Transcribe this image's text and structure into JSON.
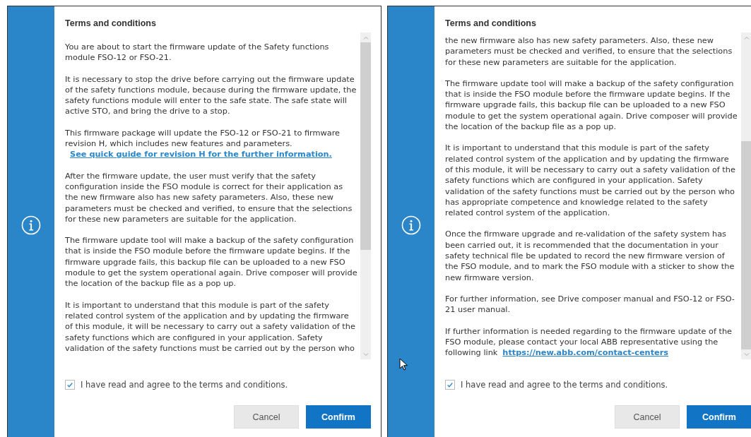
{
  "dialogs": [
    {
      "title": "Terms and conditions",
      "pointer": false,
      "paragraphs": [
        {
          "text": "You are about to start the firmware update of the Safety functions module FSO-12 or FSO-21."
        },
        {
          "text": "It is necessary to stop the drive before carrying out the firmware update of the safety functions module, because during the firmware update, the safety functions module will enter to the safe state. The safe state will active STO, and bring the drive to a stop."
        },
        {
          "text": "This firmware package will update the FSO-12 or FSO-21 to firmware revision H, which includes new features and parameters.",
          "link": "See quick guide for revision H for the further information."
        },
        {
          "text": "After the firmware update, the user must verify that the safety configuration inside the FSO module is correct for their application as the new firmware also has new safety parameters. Also, these new parameters must be checked and verified, to ensure that the selections for these new parameters are suitable for the application."
        },
        {
          "text": "The firmware update tool will make a backup of the safety configuration that is inside the FSO module before the firmware update begins. If the firmware upgrade fails, this backup file can be uploaded to a new FSO module to get the system operational again. Drive composer will provide the location of the backup file as a pop up."
        },
        {
          "text": "It is important to understand that this module is part of the safety related control system of the application and by updating the firmware of this module, it will be necessary to carry out a safety validation of the safety functions which are configured in your application. Safety validation of the safety functions must be carried out by the person who"
        }
      ],
      "agree": {
        "label": "I have read and agree to the terms and conditions.",
        "checked": true
      },
      "buttons": [
        {
          "label": "Cancel",
          "kind": "secondary"
        },
        {
          "label": "Confirm",
          "kind": "primary"
        }
      ]
    },
    {
      "title": "Terms and conditions",
      "pointer": true,
      "paragraphs": [
        {
          "text": "the new firmware also has new safety parameters. Also, these new parameters must be checked and verified, to ensure that the selections for these new parameters are suitable for the application."
        },
        {
          "text": "The firmware update tool will make a backup of the safety configuration that is inside the FSO module before the firmware update begins. If the firmware upgrade fails, this backup file can be uploaded to a new FSO module to get the system operational again. Drive composer will provide the location of the backup file as a pop up."
        },
        {
          "text": "It is important to understand that this module is part of the safety related control system of the application and by updating the firmware of this module, it will be necessary to carry out a safety validation of the safety functions which are configured in your application. Safety validation of the safety functions must be carried out by the person who has appropriate competence and knowledge related to the safety related control system of the application."
        },
        {
          "text": "Once the firmware upgrade and re-validation of the safety system has been carried out, it is recommended that the documentation in your safety technical file be updated to record the new firmware version of the FSO module, and to mark the FSO module with a sticker to show the new firmware version."
        },
        {
          "text": "For further information, see Drive composer manual and FSO-12 or FSO-21 user manual."
        },
        {
          "text": "If further information is needed regarding to the firmware update of the FSO module, please contact your local ABB representative using the following link",
          "link": "https://new.abb.com/contact-centers"
        }
      ],
      "agree": {
        "label": "I have read and agree to the terms and conditions.",
        "checked": true
      },
      "buttons": [
        {
          "label": "Cancel",
          "kind": "secondary"
        },
        {
          "label": "Confirm",
          "kind": "primary"
        }
      ]
    }
  ]
}
